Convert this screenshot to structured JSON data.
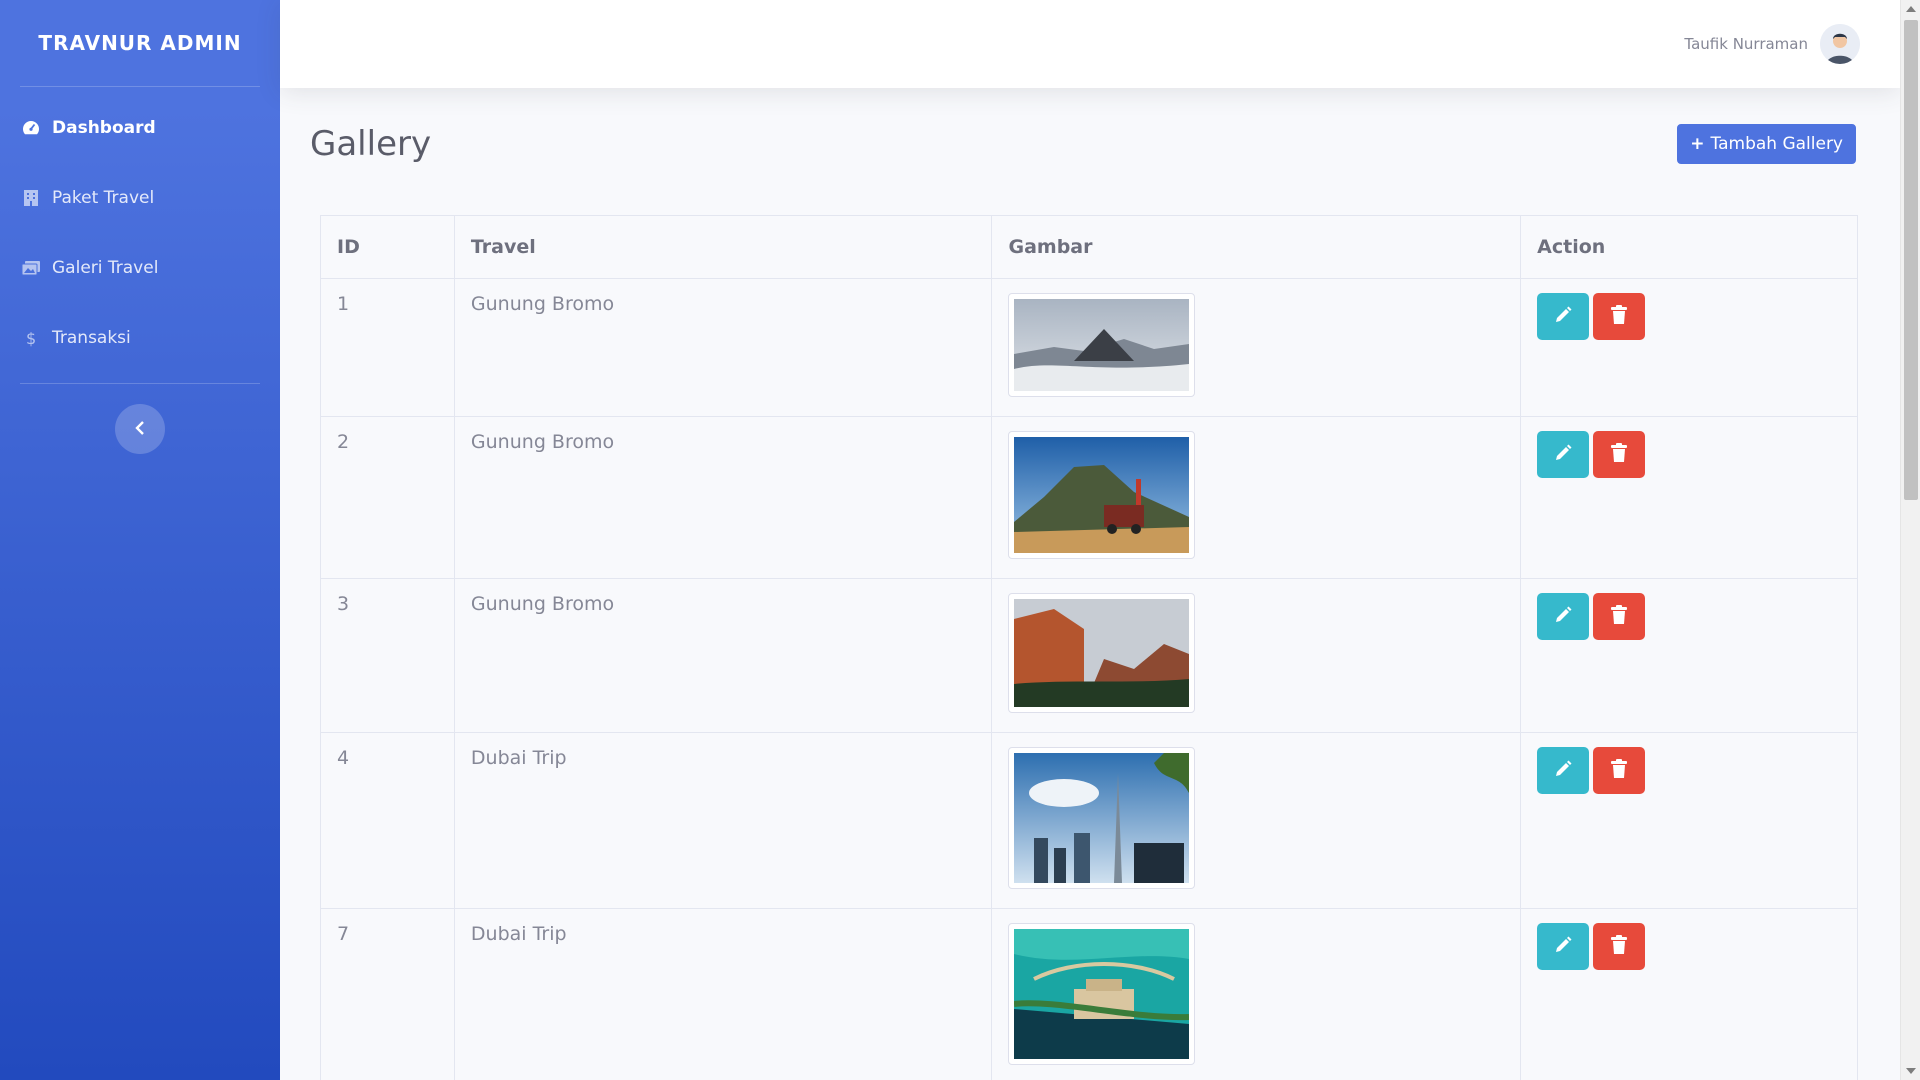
{
  "sidebar": {
    "brand": "TRAVNUR ADMIN",
    "items": [
      {
        "label": "Dashboard",
        "icon": "tachometer-icon",
        "active": true
      },
      {
        "label": "Paket Travel",
        "icon": "building-icon",
        "active": false
      },
      {
        "label": "Galeri Travel",
        "icon": "images-icon",
        "active": false
      },
      {
        "label": "Transaksi",
        "icon": "dollar-icon",
        "active": false
      }
    ],
    "toggle_icon": "chevron-left-icon"
  },
  "topbar": {
    "user_name": "Taufik Nurraman",
    "avatar_icon": "user-avatar-icon"
  },
  "page": {
    "title": "Gallery",
    "add_button_label": "Tambah Gallery"
  },
  "table": {
    "headers": [
      "ID",
      "Travel",
      "Gambar",
      "Action"
    ],
    "rows": [
      {
        "id": "1",
        "travel": "Gunung Bromo",
        "image": "bromo-misty-volcano"
      },
      {
        "id": "2",
        "travel": "Gunung Bromo",
        "image": "bromo-jeep-volcano"
      },
      {
        "id": "3",
        "travel": "Gunung Bromo",
        "image": "cliffs-valley-sunset"
      },
      {
        "id": "4",
        "travel": "Dubai Trip",
        "image": "dubai-skyline-tower"
      },
      {
        "id": "7",
        "travel": "Dubai Trip",
        "image": "dubai-island-resort"
      }
    ]
  },
  "colors": {
    "primary": "#4e73df",
    "info": "#36b9cc",
    "danger": "#e74a3b",
    "sidebar_start": "#4e73df",
    "sidebar_end": "#224abe"
  }
}
